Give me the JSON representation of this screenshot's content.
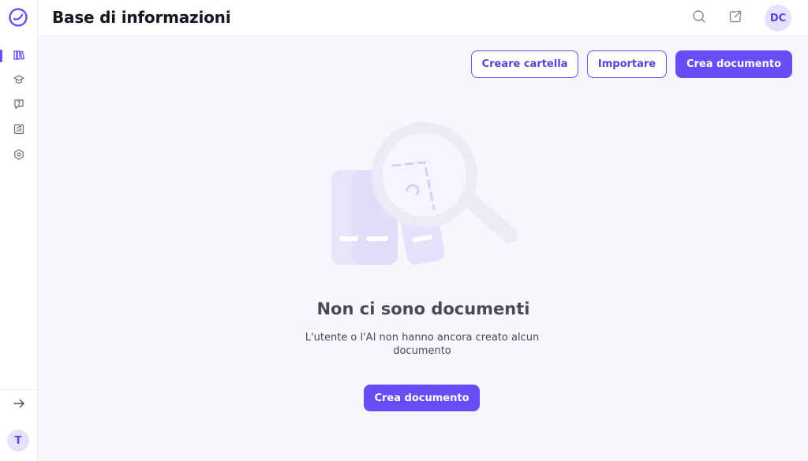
{
  "sidebar": {
    "logo": "app-logo",
    "items": [
      {
        "icon": "books-icon",
        "active": true
      },
      {
        "icon": "graduation-cap-icon",
        "active": false
      },
      {
        "icon": "chat-question-icon",
        "active": false
      },
      {
        "icon": "analytics-chart-icon",
        "active": false
      },
      {
        "icon": "settings-hexagon-icon",
        "active": false
      }
    ],
    "collapse_icon": "arrow-right-icon",
    "workspace_avatar": "T"
  },
  "header": {
    "title": "Base di informazioni",
    "search_icon": "search-icon",
    "external_icon": "external-link-icon",
    "user_initials": "DC"
  },
  "toolbar": {
    "create_folder_label": "Creare cartella",
    "import_label": "Importare",
    "create_document_label": "Crea documento"
  },
  "empty_state": {
    "title": "Non ci sono documenti",
    "description": "L'utente o l'AI non hanno ancora creato alcun documento",
    "cta_label": "Crea documento"
  },
  "colors": {
    "accent": "#6a4cf5",
    "background": "#f7f6fc",
    "illustration": "#e8e5fb"
  }
}
